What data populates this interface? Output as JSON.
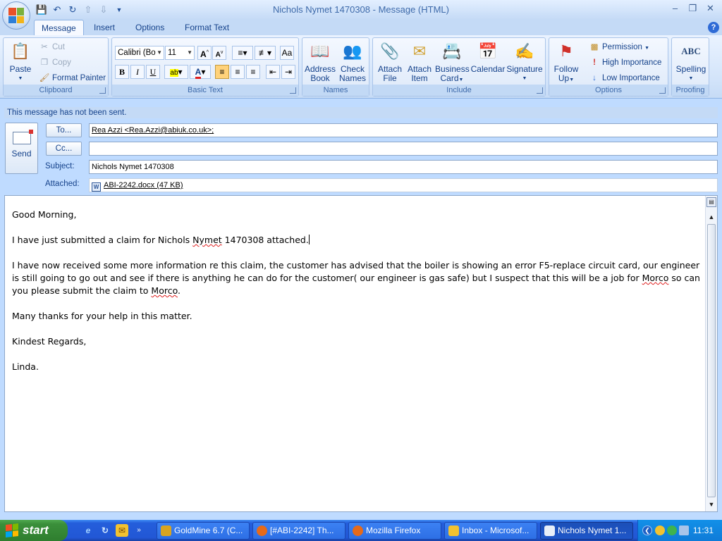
{
  "window": {
    "title": "Nichols Nymet 1470308 - Message (HTML)",
    "min": "–",
    "max": "❐",
    "close": "✕"
  },
  "tabs": [
    "Message",
    "Insert",
    "Options",
    "Format Text"
  ],
  "ribbon": {
    "clipboard": {
      "label": "Clipboard",
      "paste": "Paste",
      "cut": "Cut",
      "copy": "Copy",
      "format_painter": "Format Painter"
    },
    "basic_text": {
      "label": "Basic Text",
      "font": "Calibri (Bo",
      "size": "11"
    },
    "names": {
      "label": "Names",
      "address_book": [
        "Address",
        "Book"
      ],
      "check_names": [
        "Check",
        "Names"
      ]
    },
    "include": {
      "label": "Include",
      "attach_file": [
        "Attach",
        "File"
      ],
      "attach_item": [
        "Attach",
        "Item"
      ],
      "business_card": [
        "Business",
        "Card"
      ],
      "calendar": "Calendar",
      "signature": "Signature"
    },
    "options": {
      "label": "Options",
      "follow_up": [
        "Follow",
        "Up"
      ],
      "permission": "Permission",
      "high_importance": "High Importance",
      "low_importance": "Low Importance"
    },
    "proofing": {
      "label": "Proofing",
      "spelling": "Spelling",
      "abc": "ABC"
    }
  },
  "infobar": "This message has not been sent.",
  "send_label": "Send",
  "fields": {
    "to_button": "To...",
    "to_value": "Rea Azzi <Rea.Azzi@abiuk.co.uk>;",
    "cc_button": "Cc...",
    "cc_value": "",
    "subject_label": "Subject:",
    "subject_value": "Nichols Nymet 1470308",
    "attached_label": "Attached:",
    "attachment": "ABI-2242.docx (47 KB)"
  },
  "body": {
    "greeting": "Good Morning,",
    "p1_a": "I have just submitted a claim for Nichols ",
    "p1_b": "Nymet",
    "p1_c": " 1470308 attached.",
    "p2_a": "I have now received some more information re this claim, the customer has advised that the boiler is showing an error F5-replace circuit card, our engineer is still going to go out and see if there is anything he can do for the customer( our engineer is gas safe) but I suspect that this will be a job for ",
    "p2_b": "Morco",
    "p2_c": " so can you please submit the claim to ",
    "p2_d": "Morco",
    "p2_e": ".",
    "thanks": "Many thanks for your help in this matter.",
    "regards": "Kindest Regards,",
    "signature": "Linda."
  },
  "taskbar": {
    "start": "start",
    "tasks": [
      "GoldMine 6.7 (C...",
      "[#ABI-2242] Th...",
      "Mozilla Firefox",
      "Inbox - Microsof...",
      "Nichols Nymet 1..."
    ],
    "clock": "11:31"
  }
}
